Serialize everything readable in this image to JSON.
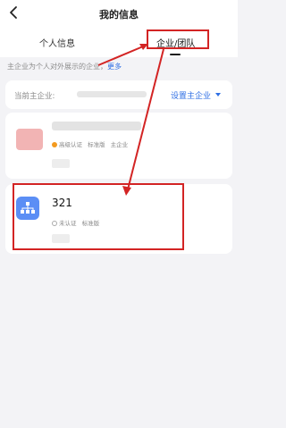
{
  "header": {
    "title": "我的信息"
  },
  "tabs": [
    {
      "label": "个人信息"
    },
    {
      "label": "企业/团队"
    }
  ],
  "tip": {
    "text": "主企业为个人对外展示的企业，",
    "more": "更多"
  },
  "main_enterprise": {
    "label": "当前主企业:",
    "set_label": "设置主企业"
  },
  "enterprise1": {
    "badge_verified": "高级认证",
    "badge_plan": "标准版",
    "badge_main": "主企业"
  },
  "enterprise2": {
    "name": "321",
    "badge_status": "未认证",
    "badge_plan": "标准版"
  },
  "colors": {
    "accent": "#2f6fe4",
    "annotation": "#d32424",
    "logo_blue": "#5b8ef5"
  }
}
